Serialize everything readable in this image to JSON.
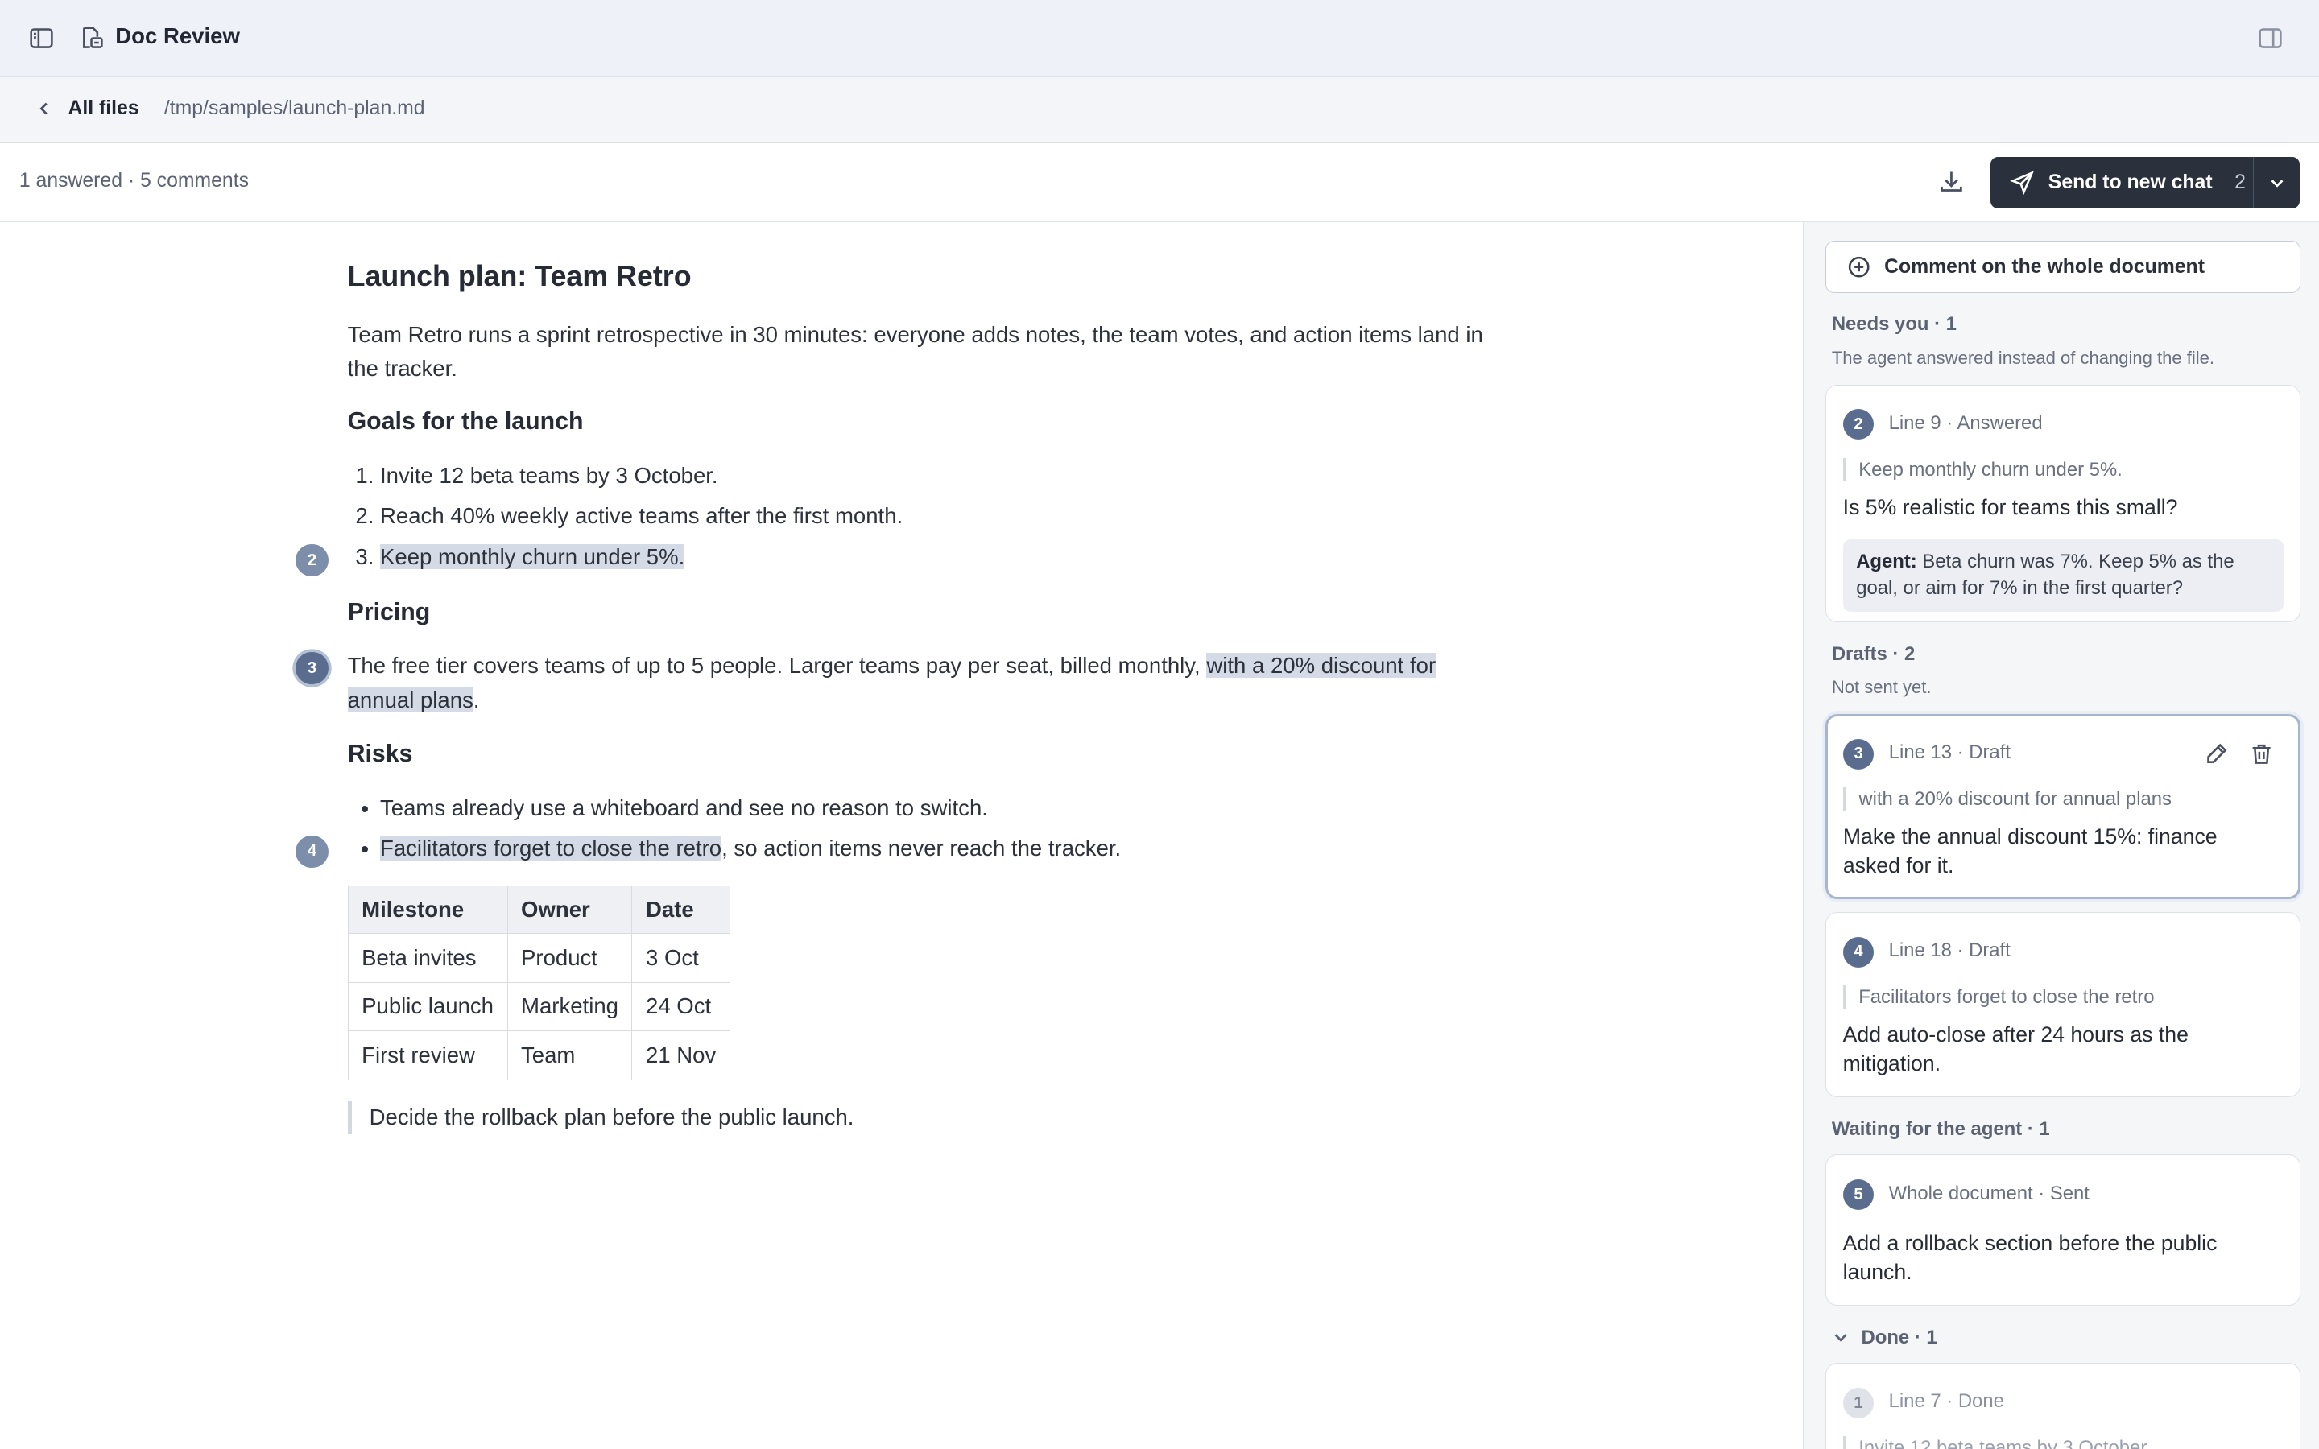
{
  "app": {
    "title": "Doc Review"
  },
  "pathbar": {
    "back_label": "All files",
    "path": "/tmp/samples/launch-plan.md"
  },
  "toolbar": {
    "summary": "1 answered · 5 comments",
    "send_label": "Send to new chat",
    "send_count": "2"
  },
  "doc": {
    "title": "Launch plan: Team Retro",
    "intro": "Team Retro runs a sprint retrospective in 30 minutes: everyone adds notes, the team votes, and action items land in the tracker.",
    "goals_heading": "Goals for the launch",
    "goals": [
      "Invite 12 beta teams by 3 October.",
      "Reach 40% weekly active teams after the first month.",
      "Keep monthly churn under 5%."
    ],
    "pricing_heading": "Pricing",
    "pricing_pre": "The free tier covers teams of up to 5 people. Larger teams pay per seat, billed monthly, ",
    "pricing_hl": "with a 20% discount for annual plans",
    "pricing_post": ".",
    "risks_heading": "Risks",
    "risk_1": "Teams already use a whiteboard and see no reason to switch.",
    "risk_2_hl": "Facilitators forget to close the retro",
    "risk_2_post": ", so action items never reach the tracker.",
    "table": {
      "headers": [
        "Milestone",
        "Owner",
        "Date"
      ],
      "rows": [
        [
          "Beta invites",
          "Product",
          "3 Oct"
        ],
        [
          "Public launch",
          "Marketing",
          "24 Oct"
        ],
        [
          "First review",
          "Team",
          "21 Nov"
        ]
      ]
    },
    "blockquote": "Decide the rollback plan before the public launch.",
    "markers": [
      "2",
      "3",
      "4"
    ]
  },
  "sidebar": {
    "whole_doc_label": "Comment on the whole document",
    "needs_you": {
      "title": "Needs you · 1",
      "subtitle": "The agent answered instead of changing the file."
    },
    "drafts": {
      "title": "Drafts · 2",
      "subtitle": "Not sent yet."
    },
    "waiting": {
      "title": "Waiting for the agent · 1"
    },
    "done": {
      "title": "Done · 1"
    },
    "cards": [
      {
        "num": "2",
        "meta": "Line 9 · Answered",
        "quote": "Keep monthly churn under 5%.",
        "body": "Is 5% realistic for teams this small?",
        "agent_label": "Agent:",
        "agent_text": " Beta churn was 7%. Keep 5% as the goal, or aim for 7% in the first quarter?"
      },
      {
        "num": "3",
        "meta": "Line 13 · Draft",
        "quote": "with a 20% discount for annual plans",
        "body": "Make the annual discount 15%: finance asked for it."
      },
      {
        "num": "4",
        "meta": "Line 18 · Draft",
        "quote": "Facilitators forget to close the retro",
        "body": "Add auto-close after 24 hours as the mitigation."
      },
      {
        "num": "5",
        "meta": "Whole document · Sent",
        "body": "Add a rollback section before the public launch."
      },
      {
        "num": "1",
        "meta": "Line 7 · Done",
        "quote": "Invite 12 beta teams by 3 October."
      }
    ]
  }
}
